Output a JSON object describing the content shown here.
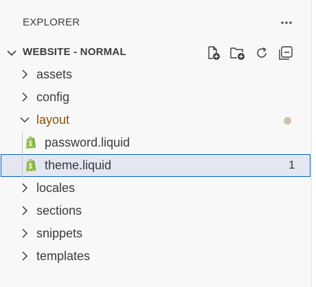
{
  "header": {
    "title": "EXPLORER",
    "more_icon": "ellipsis-icon"
  },
  "section": {
    "title": "WEBSITE - NORMAL",
    "expanded": true,
    "actions": [
      {
        "name": "new-file-button",
        "icon": "new-file-icon"
      },
      {
        "name": "new-folder-button",
        "icon": "new-folder-icon"
      },
      {
        "name": "refresh-button",
        "icon": "refresh-icon"
      },
      {
        "name": "collapse-all-button",
        "icon": "collapse-all-icon"
      }
    ]
  },
  "tree": {
    "folders": [
      {
        "label": "assets",
        "expanded": false
      },
      {
        "label": "config",
        "expanded": false
      },
      {
        "label": "layout",
        "expanded": true,
        "modified": true,
        "children": [
          {
            "label": "password.liquid",
            "icon": "shopify-liquid-icon",
            "selected": false
          },
          {
            "label": "theme.liquid",
            "icon": "shopify-liquid-icon",
            "selected": true,
            "problem_count": "1"
          }
        ]
      },
      {
        "label": "locales",
        "expanded": false
      },
      {
        "label": "sections",
        "expanded": false
      },
      {
        "label": "snippets",
        "expanded": false
      },
      {
        "label": "templates",
        "expanded": false
      }
    ]
  },
  "colors": {
    "modified_folder": "#895503",
    "modified_dot": "#d1c3a3",
    "selection_border": "#0060c0",
    "selection_bg": "#e4e6f1",
    "shopify_green": "#95bf47"
  }
}
